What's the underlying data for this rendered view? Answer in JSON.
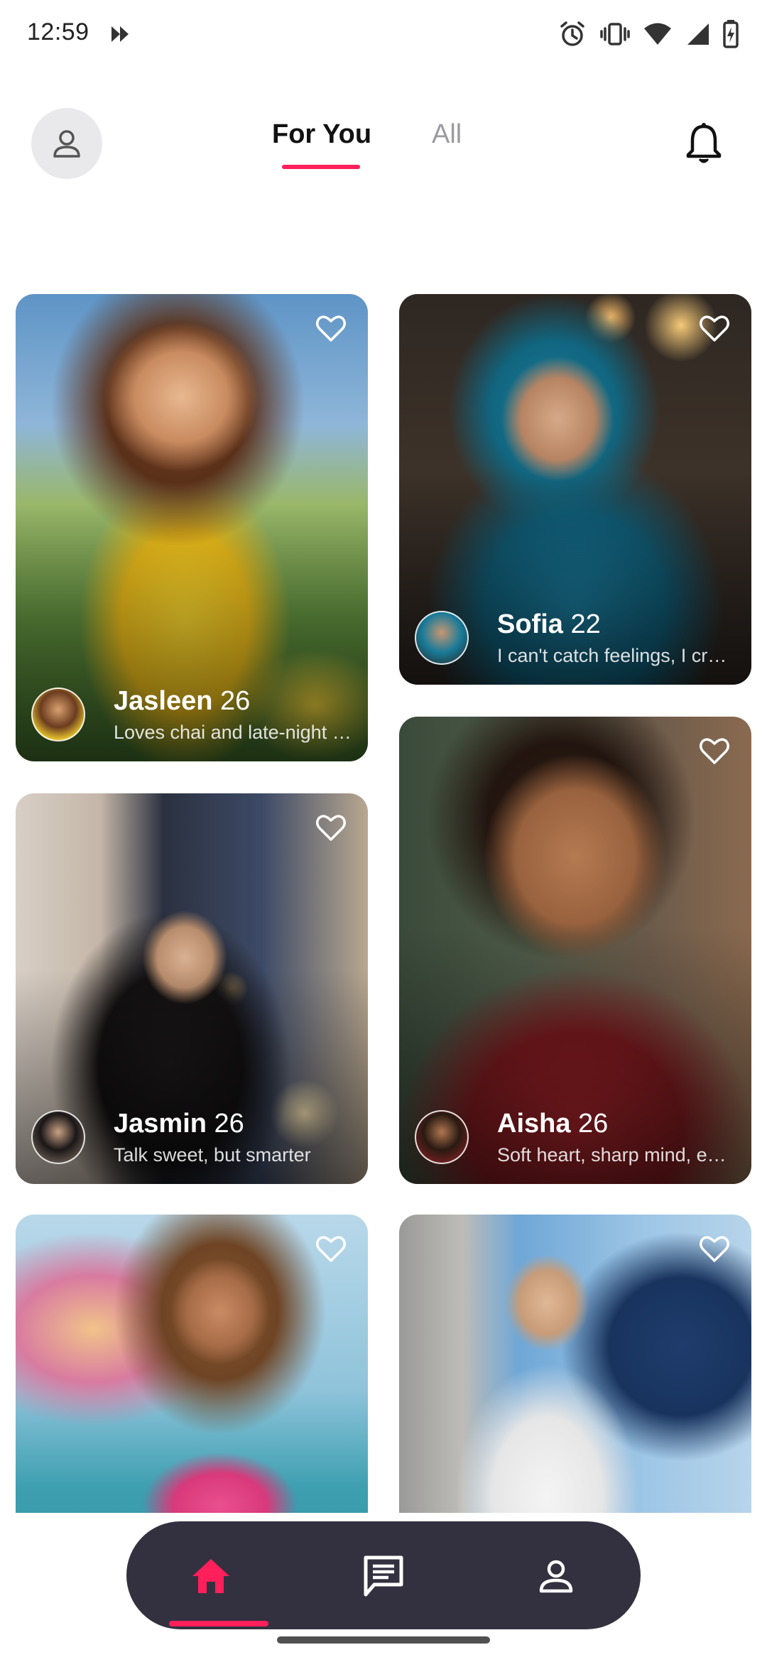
{
  "status_bar": {
    "time": "12:59",
    "left_icon": "media-cast-icon",
    "right_icons": [
      "alarm-icon",
      "vibrate-icon",
      "wifi-icon",
      "signal-icon",
      "battery-charging-icon"
    ]
  },
  "header": {
    "tabs": [
      {
        "label": "For You",
        "active": true
      },
      {
        "label": "All",
        "active": false
      }
    ],
    "left_icon": "profile-icon",
    "right_icon": "bell-icon"
  },
  "cards": [
    {
      "name": "Jasleen",
      "age": "26",
      "bio": "Loves chai and late-night …"
    },
    {
      "name": "Sofia",
      "age": "22",
      "bio": "I can't catch feelings, I cre…"
    },
    {
      "name": "Jasmin",
      "age": "26",
      "bio": "Talk sweet, but smarter"
    },
    {
      "name": "Aisha",
      "age": "26",
      "bio": "Soft heart, sharp mind, en…"
    },
    {
      "name": "",
      "age": "",
      "bio": ""
    },
    {
      "name": "",
      "age": "",
      "bio": ""
    }
  ],
  "bottom_nav": {
    "items": [
      {
        "icon": "home-icon",
        "active": true
      },
      {
        "icon": "chat-icon",
        "active": false
      },
      {
        "icon": "profile-icon",
        "active": false
      }
    ]
  },
  "colors": {
    "accent": "#ff1f5a",
    "nav_bg": "#33313f",
    "inactive_tab": "#9a9aa0"
  }
}
